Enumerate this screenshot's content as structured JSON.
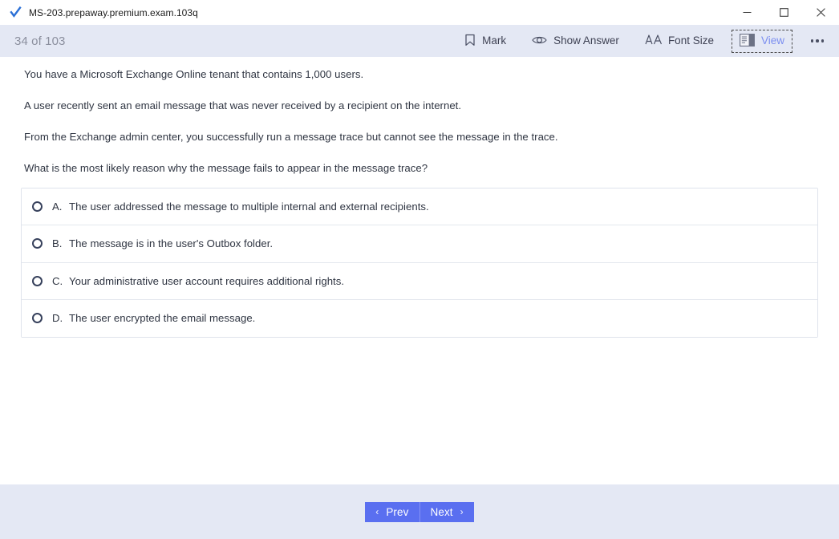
{
  "window": {
    "title": "MS-203.prepaway.premium.exam.103q",
    "app_icon": "blue-check-icon",
    "controls": {
      "minimize": "–",
      "maximize": "☐",
      "close": "✕"
    }
  },
  "header": {
    "question_counter": "34 of 103",
    "toolbar": [
      {
        "label": "Mark",
        "icon": "bookmark-icon",
        "active": false
      },
      {
        "label": "Show Answer",
        "icon": "eye-icon",
        "active": false
      },
      {
        "label": "Font Size",
        "icon": "font-size-icon",
        "active": false
      },
      {
        "label": "View",
        "icon": "layout-panel-icon",
        "active": true
      }
    ],
    "more_label": "More options"
  },
  "question": {
    "stem": [
      "You have a Microsoft Exchange Online tenant that contains 1,000 users.",
      "A user recently sent an email message that was never received by a recipient on the internet.",
      "From the Exchange admin center, you successfully run a message trace but cannot see the message in the trace.",
      "What is the most likely reason why the message fails to appear in the message trace?"
    ],
    "options": [
      {
        "letter": "A.",
        "text": "The user addressed the message to multiple internal and external recipients.",
        "selected": false
      },
      {
        "letter": "B.",
        "text": "The message is in the user's Outbox folder.",
        "selected": false
      },
      {
        "letter": "C.",
        "text": "Your administrative user account requires additional rights.",
        "selected": false
      },
      {
        "letter": "D.",
        "text": "The user encrypted the email message.",
        "selected": false
      }
    ]
  },
  "footer": {
    "prev_label": "Prev",
    "next_label": "Next",
    "prev_chevron": "‹",
    "next_chevron": "›"
  },
  "colors": {
    "header_bg": "#e4e8f4",
    "footer_bg": "#e4e8f4",
    "accent_button": "#5a6ff0",
    "view_active_text": "#7b8ef0",
    "text": "#2f3542",
    "counter_text": "#8b8f9e"
  }
}
